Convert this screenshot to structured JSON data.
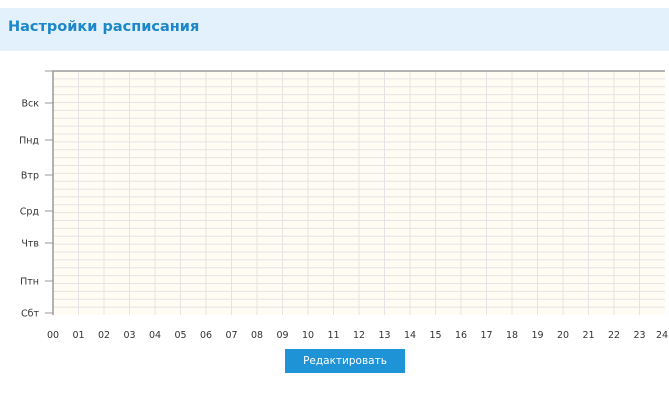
{
  "header": {
    "title": "Настройки расписания"
  },
  "schedule": {
    "days": [
      "Вск",
      "Пнд",
      "Втр",
      "Срд",
      "Чтв",
      "Птн",
      "Сбт"
    ],
    "hours": [
      "00",
      "01",
      "02",
      "03",
      "04",
      "05",
      "06",
      "07",
      "08",
      "09",
      "10",
      "11",
      "12",
      "13",
      "14",
      "15",
      "16",
      "17",
      "18",
      "19",
      "20",
      "21",
      "22",
      "23",
      "24"
    ],
    "selected_slots": [],
    "colors": {
      "plot_background": "#fffcf3",
      "grid": "#e4e4e4",
      "frame": "#9a9a9a"
    }
  },
  "actions": {
    "edit_label": "Редактировать"
  }
}
